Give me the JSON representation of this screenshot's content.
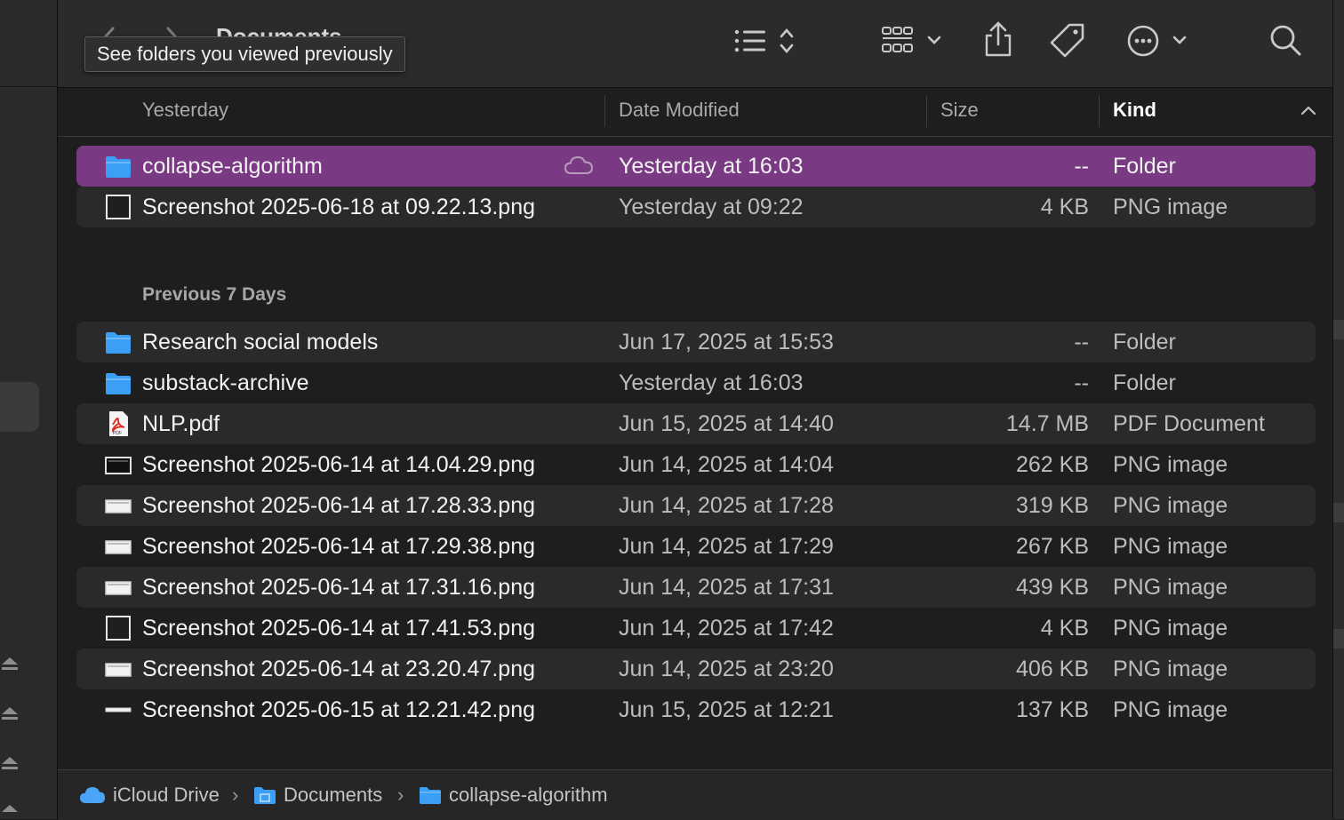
{
  "window": {
    "title": "Documents",
    "tooltip": "See folders you viewed previously"
  },
  "toolbar": {
    "buttons": [
      "list-view-icon",
      "group-icon",
      "share-icon",
      "tag-icon",
      "more-icon",
      "search-icon"
    ]
  },
  "columns": {
    "name": "Yesterday",
    "date": "Date Modified",
    "size": "Size",
    "kind": "Kind"
  },
  "groups": [
    {
      "label": "Yesterday",
      "rows": [
        {
          "name": "collapse-algorithm",
          "date": "Yesterday at 16:03",
          "size": "--",
          "kind": "Folder",
          "icon": "folder-icon",
          "selected": true,
          "icloud": true
        },
        {
          "name": "Screenshot 2025-06-18 at 09.22.13.png",
          "date": "Yesterday at 09:22",
          "size": "4 KB",
          "kind": "PNG image",
          "icon": "image-blank-icon"
        }
      ]
    },
    {
      "label": "Previous 7 Days",
      "rows": [
        {
          "name": "Research social models",
          "date": "Jun 17, 2025 at 15:53",
          "size": "--",
          "kind": "Folder",
          "icon": "folder-icon"
        },
        {
          "name": "substack-archive",
          "date": "Yesterday at 16:03",
          "size": "--",
          "kind": "Folder",
          "icon": "folder-icon"
        },
        {
          "name": "NLP.pdf",
          "date": "Jun 15, 2025 at 14:40",
          "size": "14.7 MB",
          "kind": "PDF Document",
          "icon": "pdf-icon"
        },
        {
          "name": "Screenshot 2025-06-14 at 14.04.29.png",
          "date": "Jun 14, 2025 at 14:04",
          "size": "262 KB",
          "kind": "PNG image",
          "icon": "image-dark-icon"
        },
        {
          "name": "Screenshot 2025-06-14 at 17.28.33.png",
          "date": "Jun 14, 2025 at 17:28",
          "size": "319 KB",
          "kind": "PNG image",
          "icon": "image-light-icon"
        },
        {
          "name": "Screenshot 2025-06-14 at 17.29.38.png",
          "date": "Jun 14, 2025 at 17:29",
          "size": "267 KB",
          "kind": "PNG image",
          "icon": "image-light-icon"
        },
        {
          "name": "Screenshot 2025-06-14 at 17.31.16.png",
          "date": "Jun 14, 2025 at 17:31",
          "size": "439 KB",
          "kind": "PNG image",
          "icon": "image-light-icon"
        },
        {
          "name": "Screenshot 2025-06-14 at 17.41.53.png",
          "date": "Jun 14, 2025 at 17:42",
          "size": "4 KB",
          "kind": "PNG image",
          "icon": "image-blank-icon"
        },
        {
          "name": "Screenshot 2025-06-14 at 23.20.47.png",
          "date": "Jun 14, 2025 at 23:20",
          "size": "406 KB",
          "kind": "PNG image",
          "icon": "image-light-icon"
        },
        {
          "name": "Screenshot 2025-06-15 at 12.21.42.png",
          "date": "Jun 15, 2025 at 12:21",
          "size": "137 KB",
          "kind": "PNG image",
          "icon": "image-strip-icon"
        }
      ]
    }
  ],
  "pathbar": [
    {
      "label": "iCloud Drive",
      "icon": "icloud-icon"
    },
    {
      "label": "Documents",
      "icon": "documents-folder-icon"
    },
    {
      "label": "collapse-algorithm",
      "icon": "folder-icon"
    }
  ],
  "colors": {
    "selection": "#7a3a83",
    "folder": "#3a9ff5",
    "alt_row": "#2a2a2a"
  }
}
